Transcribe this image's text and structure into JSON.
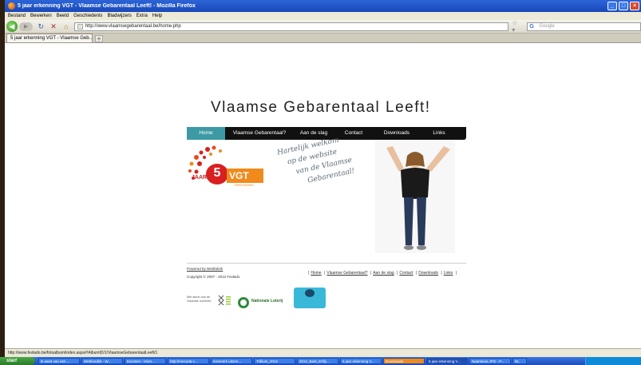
{
  "window": {
    "title": "5 jaar erkenning VGT - Vlaamse Gebarentaal Leeft! - Mozilla Firefox",
    "min": "_",
    "max": "□",
    "close": "×"
  },
  "menu": [
    "Bestand",
    "Bewerken",
    "Beeld",
    "Geschiedenis",
    "Bladwijzers",
    "Extra",
    "Help"
  ],
  "toolbar": {
    "back": "◀",
    "forward": "▶",
    "reload": "↻",
    "stop": "✕",
    "home": "⌂",
    "url": "http://www.vlaamsegebarentaal.be/home.php",
    "search_placeholder": "Google",
    "search_engine": "G",
    "star": "☆ ▾"
  },
  "tabs": [
    {
      "label": "5 jaar erkenning VGT - Vlaamse Geb..."
    }
  ],
  "tab_new": "+",
  "site": {
    "title": "Vlaamse Gebarentaal Leeft!",
    "nav": [
      "Home",
      "Vlaamse Gebarentaal?",
      "Aan de slag",
      "Contact",
      "Downloads",
      "Links"
    ],
    "logo": {
      "number": "5",
      "jaar": "JAAR",
      "vgt": "VGT",
      "sub": "ERKENNING"
    },
    "welcome": [
      "Hartelijk welkom",
      "op de website",
      "van de Vlaamse",
      "Gebarentaal!"
    ],
    "footer": {
      "powered": "Powered by Webfabrik",
      "copyright": "Copyright © 2007 - 2012 Fevlado",
      "links": [
        "Home",
        "Vlaamse Gebarentaal?",
        "Aan de slag",
        "Contact",
        "Downloads",
        "Links"
      ]
    },
    "sponsors": {
      "vlaanderen": "Met steun van de Vlaamse overheid",
      "loterij": "Nationale Loterij"
    }
  },
  "status": "http://www.fevlado.be/fotoalbum/index.aspx#!AlbumID/1/VlaamseGebarentaalLeeft/1",
  "taskbar": {
    "start": "start",
    "tasks": [
      "Ik weet van een ...",
      "Webfundkit - W...",
      "Eurotext - Vrien...",
      "http://mezuda-c...",
      "Kenmerk uitzen...",
      "Trillium_2012",
      "2012_Bark_Erfdj...",
      "5 jaar erkenning V...",
      "Downloads",
      "5 jaar erkenning V...",
      "Naamloos.JPG - P...",
      "NL"
    ]
  },
  "colors": {
    "nav_active": "#3d9aa4",
    "nav_bg": "#111111",
    "logo_red": "#d82020",
    "logo_orange": "#f08a1c"
  }
}
